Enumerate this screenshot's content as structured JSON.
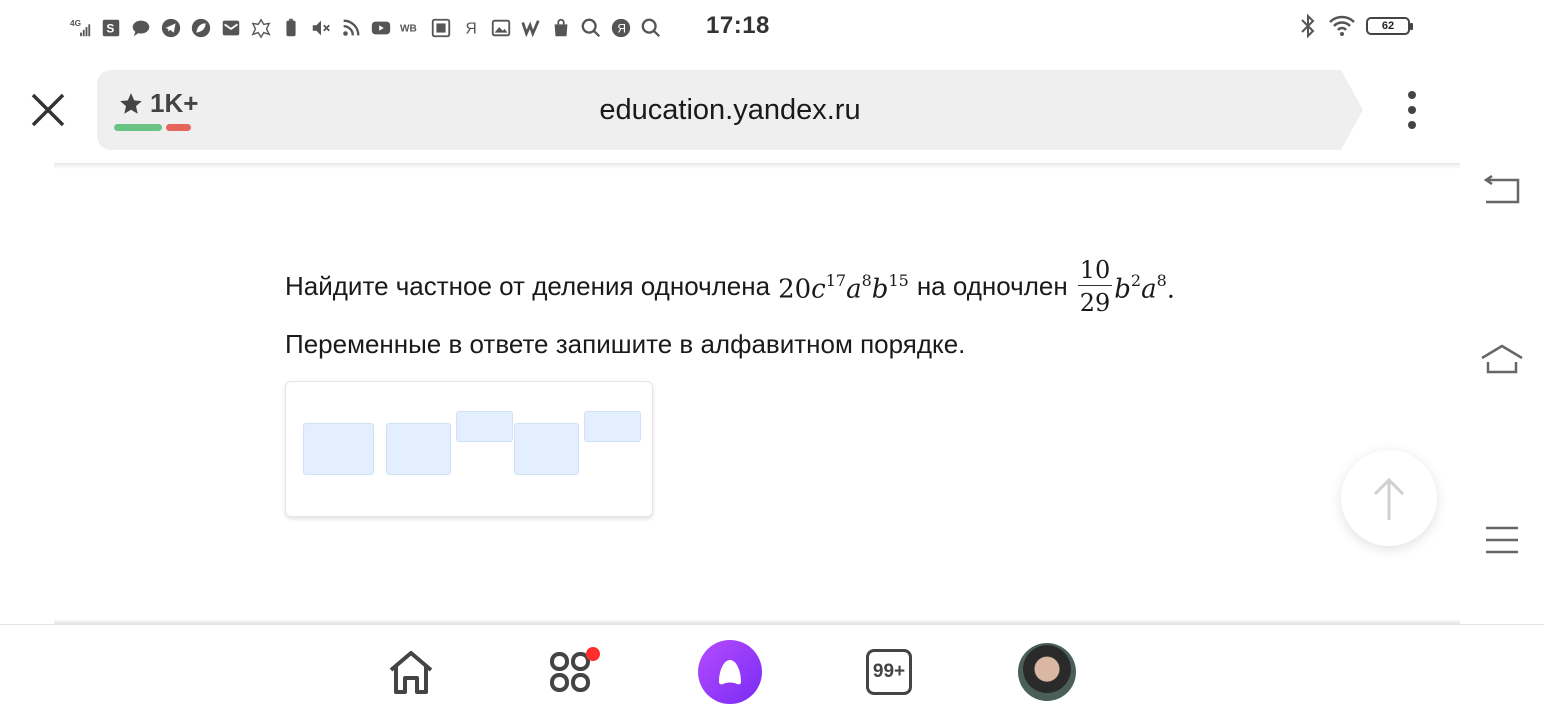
{
  "status_bar": {
    "time": "17:18",
    "network": "4G",
    "battery": "62",
    "icons": [
      "signal-4g-icon",
      "s-app-icon",
      "chat-icon",
      "telegram-icon",
      "leaf-icon",
      "mail-icon",
      "emblem-icon",
      "battery-saver-icon",
      "mute-icon",
      "rss-icon",
      "youtube-icon",
      "wb-icon",
      "gallery-icon",
      "ya-icon",
      "image-icon",
      "w-icon",
      "shopping-icon",
      "search-icon",
      "yandex-icon",
      "search-icon"
    ],
    "wb_label": "WB",
    "ya_label": "Я"
  },
  "browser": {
    "rating": "1K+",
    "url": "education.yandex.ru"
  },
  "task": {
    "text_before": "Найдите частное от деления одночлена",
    "monomial1": {
      "coef": "20",
      "vars": [
        {
          "v": "c",
          "p": "17"
        },
        {
          "v": "a",
          "p": "8"
        },
        {
          "v": "b",
          "p": "15"
        }
      ]
    },
    "text_middle": "на одночлен",
    "monomial2": {
      "num": "10",
      "den": "29",
      "vars": [
        {
          "v": "b",
          "p": "2"
        },
        {
          "v": "a",
          "p": "8"
        }
      ]
    },
    "period": ".",
    "line2": "Переменные в ответе запишите в алфавитном порядке."
  },
  "bottom_nav": {
    "badge": "99+",
    "items": [
      "home-icon",
      "services-icon",
      "alice-icon",
      "tabs-counter",
      "profile-avatar"
    ]
  },
  "colors": {
    "accent": "#8a34f7",
    "slot_fill": "#e3efff",
    "rating_good": "#69c383",
    "rating_bad": "#e5655b"
  }
}
